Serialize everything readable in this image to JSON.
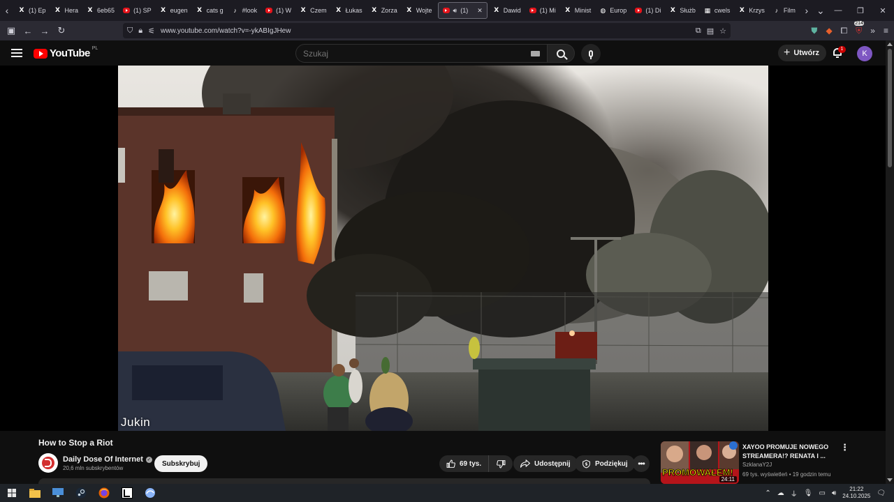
{
  "browser": {
    "tabs": [
      {
        "label": "(1) Ep",
        "icon": "x-icon"
      },
      {
        "label": "Hera",
        "icon": "x-icon"
      },
      {
        "label": "6eb65",
        "icon": "x-icon"
      },
      {
        "label": "(1) SP",
        "icon": "youtube-icon"
      },
      {
        "label": "eugen",
        "icon": "x-icon"
      },
      {
        "label": "cats g",
        "icon": "x-icon"
      },
      {
        "label": "#look",
        "icon": "tiktok-icon"
      },
      {
        "label": "(1) W",
        "icon": "youtube-icon"
      },
      {
        "label": "Czem",
        "icon": "x-icon"
      },
      {
        "label": "Łukas",
        "icon": "x-icon"
      },
      {
        "label": "Zorza",
        "icon": "x-icon"
      },
      {
        "label": "Wojte",
        "icon": "x-icon"
      },
      {
        "label": "(1)",
        "icon": "youtube-icon",
        "active": true
      },
      {
        "label": "Dawid",
        "icon": "x-icon"
      },
      {
        "label": "(1) Mi",
        "icon": "youtube-icon"
      },
      {
        "label": "Minist",
        "icon": "x-icon"
      },
      {
        "label": "Europ",
        "icon": "globe-icon"
      },
      {
        "label": "(1) Di",
        "icon": "youtube-icon"
      },
      {
        "label": "Służb",
        "icon": "x-icon"
      },
      {
        "label": "cwels",
        "icon": "grid-icon"
      },
      {
        "label": "Krzys",
        "icon": "x-icon"
      },
      {
        "label": "Film",
        "icon": "tiktok-icon"
      }
    ],
    "url": "www.youtube.com/watch?v=-ykABIgJHew",
    "extensions_badge": "214"
  },
  "youtube": {
    "logo_text": "YouTube",
    "region": "PL",
    "search_placeholder": "Szukaj",
    "create_label": "Utwórz",
    "notifications_count": "1",
    "avatar_letter": "K"
  },
  "video": {
    "watermark": "Jukin",
    "title": "How to Stop a Riot",
    "channel_name": "Daily Dose Of Internet",
    "subscribers": "20,6 mln subskrybentów",
    "subscribe_label": "Subskrybuj",
    "likes": "69 tys.",
    "share_label": "Udostępnij",
    "thanks_label": "Podziękuj"
  },
  "recommendation": {
    "title": "XAYOO PROMUJE NOWEGO STREAMERA!? RENATA I ...",
    "channel": "SzklanaY2J",
    "meta": "69 tys. wyświetleń • 19 godzin temu",
    "duration": "24:11",
    "thumb_text": "PROMOWAŁEM!"
  },
  "taskbar": {
    "time": "21:22",
    "date": "24.10.2025"
  }
}
